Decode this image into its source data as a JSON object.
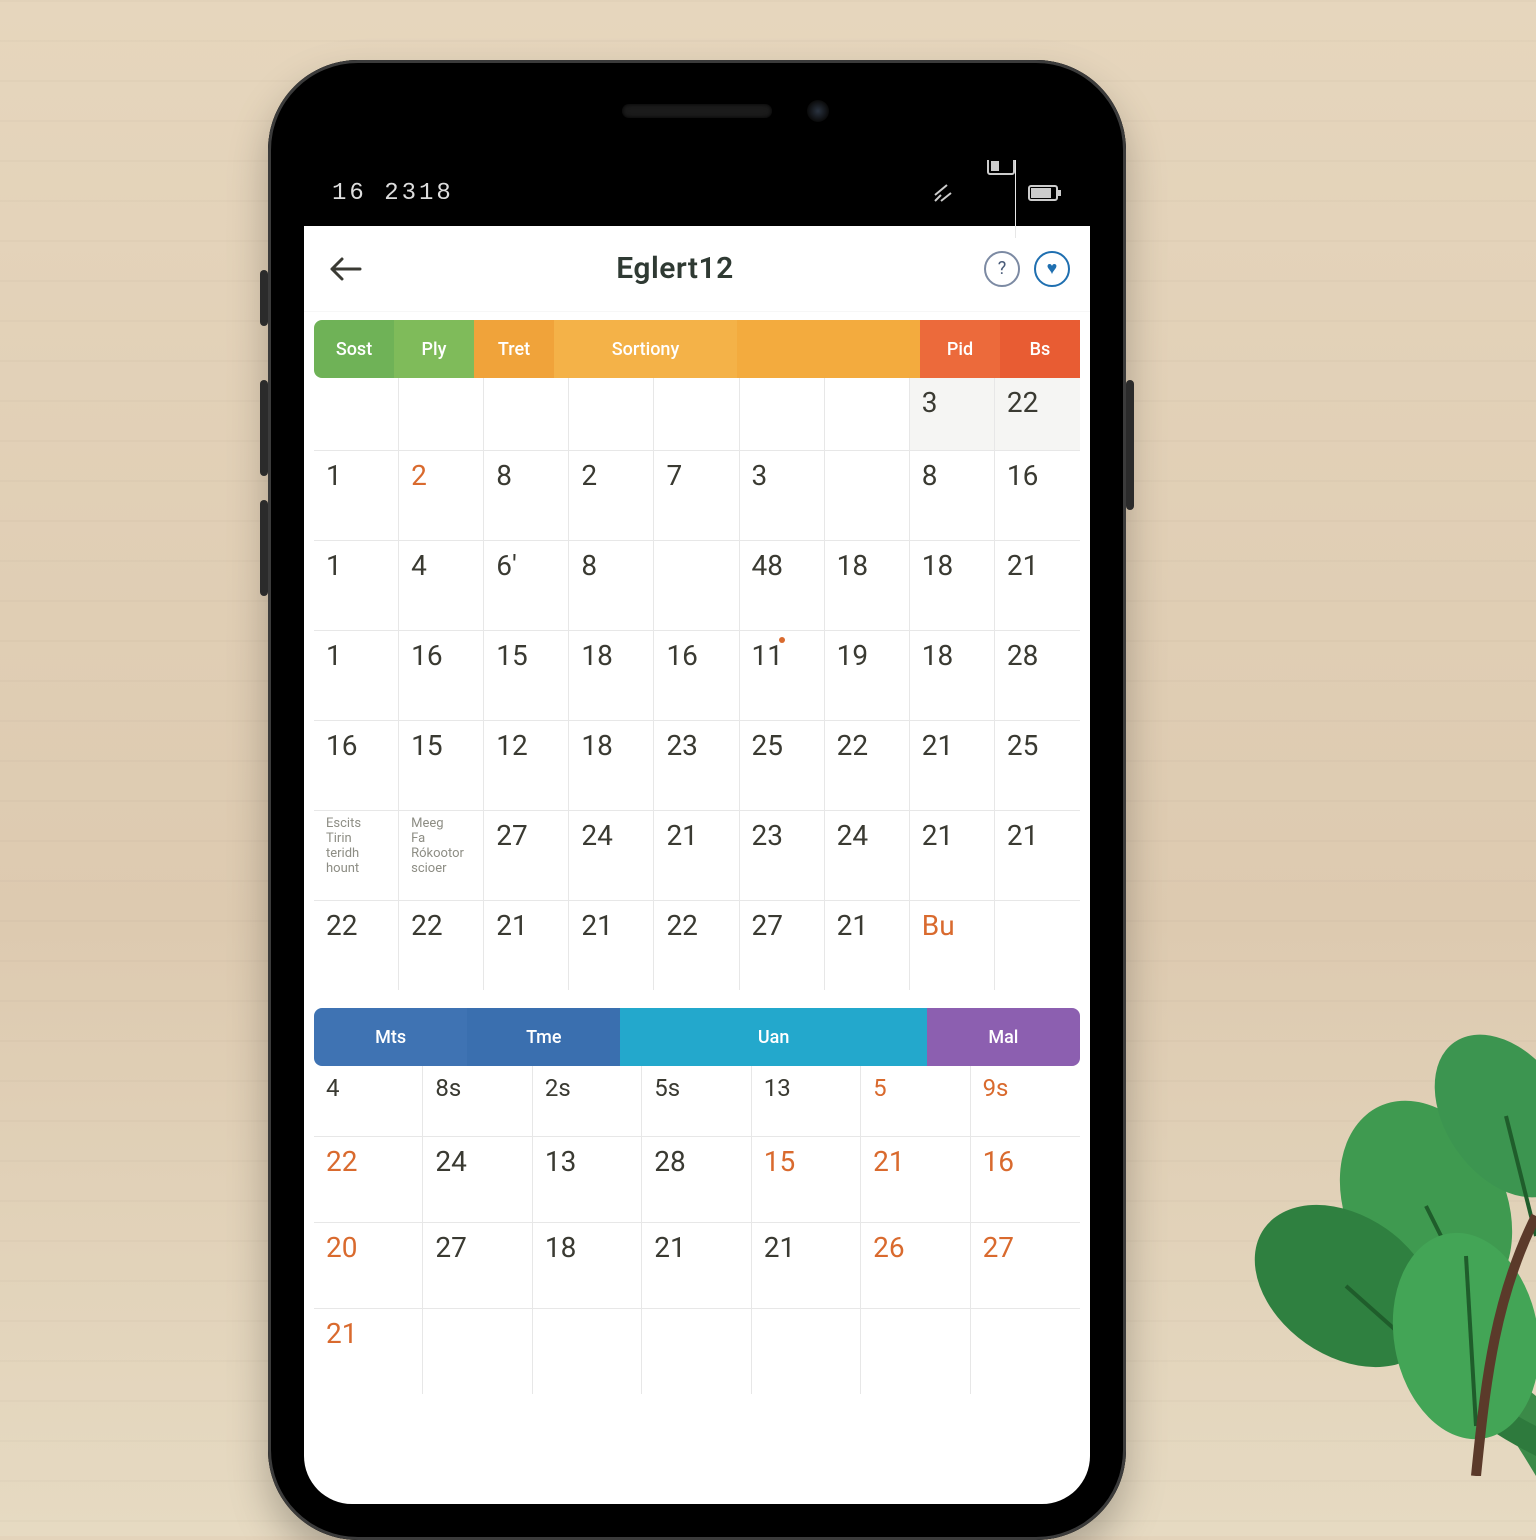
{
  "status": {
    "time": "16 2318"
  },
  "header": {
    "title": "Eglert12",
    "action1": "?",
    "action2": "♥"
  },
  "tabs_top": [
    {
      "label": "Sost",
      "cls": "green"
    },
    {
      "label": "Ply",
      "cls": "green2"
    },
    {
      "label": "Tret",
      "cls": "amber"
    },
    {
      "label": "Sortiony",
      "cls": "amber2"
    },
    {
      "label": "",
      "cls": "amber3"
    },
    {
      "label": "Pid",
      "cls": "orange"
    },
    {
      "label": "Bs",
      "cls": "orange2"
    }
  ],
  "grid1": [
    {
      "short": true,
      "cells": [
        "",
        "",
        "",
        "",
        "",
        "",
        "",
        "3",
        "22"
      ],
      "flags": [
        "",
        "",
        "",
        "",
        "",
        "",
        "",
        "shade",
        "shade"
      ]
    },
    {
      "cells": [
        "1",
        "2",
        "8",
        "2",
        "7",
        "3",
        "",
        "8",
        "16"
      ],
      "flags": [
        "",
        "or",
        "",
        "",
        "",
        "",
        "",
        "",
        ""
      ]
    },
    {
      "cells": [
        "1",
        "4",
        "6'",
        "8",
        "",
        "48",
        "18",
        "18",
        "21"
      ]
    },
    {
      "cells": [
        "1",
        "16",
        "15",
        "18",
        "16",
        "11",
        "19",
        "18",
        "28"
      ],
      "dots": [
        false,
        false,
        false,
        false,
        false,
        true,
        false,
        false,
        false
      ]
    },
    {
      "cells": [
        "16",
        "15",
        "12",
        "18",
        "23",
        "25",
        "22",
        "21",
        "25"
      ]
    },
    {
      "small": true,
      "cells": [
        "Escits\nTirin\nteridh\nhount",
        "Meeg\nFa\nRókootor\nscioer",
        "27",
        "24",
        "21",
        "23",
        "24",
        "21",
        "21"
      ]
    },
    {
      "cells": [
        "22",
        "22",
        "21",
        "21",
        "22",
        "27",
        "21",
        "Bu",
        ""
      ],
      "flags": [
        "",
        "",
        "",
        "",
        "",
        "",
        "",
        "or",
        ""
      ]
    }
  ],
  "tabs_bottom": [
    {
      "label": "Mts",
      "cls": "blue"
    },
    {
      "label": "Tme",
      "cls": "blue2"
    },
    {
      "label": "Uan",
      "cls": "cyan"
    },
    {
      "label": "Mal",
      "cls": "purple"
    }
  ],
  "grid2": [
    {
      "top": true,
      "cells": [
        "4",
        "8s",
        "2s",
        "5s",
        "13",
        "5",
        "9s"
      ],
      "flags": [
        "",
        "",
        "",
        "",
        "",
        "or",
        "or"
      ]
    },
    {
      "cells": [
        "22",
        "24",
        "13",
        "28",
        "15",
        "21",
        "16"
      ],
      "flags": [
        "or",
        "",
        "",
        "",
        "or",
        "or",
        "or"
      ]
    },
    {
      "cells": [
        "20",
        "27",
        "18",
        "21",
        "21",
        "26",
        "27"
      ],
      "flags": [
        "or",
        "",
        "",
        "",
        "",
        "or",
        "or"
      ]
    },
    {
      "cells": [
        "21",
        "",
        "",
        "",
        "",
        "",
        ""
      ],
      "flags": [
        "or",
        "",
        "",
        "",
        "",
        "",
        ""
      ]
    }
  ]
}
